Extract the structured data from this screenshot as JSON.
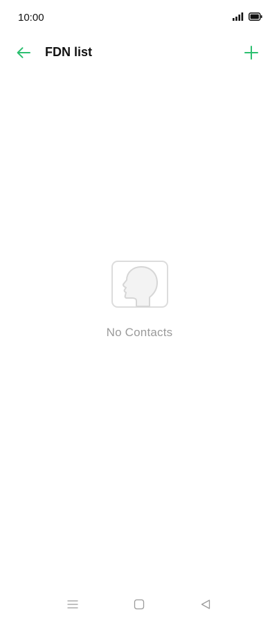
{
  "status_bar": {
    "time": "10:00"
  },
  "header": {
    "title": "FDN list"
  },
  "empty_state": {
    "message": "No Contacts"
  },
  "colors": {
    "accent": "#2bbf6f",
    "muted_text": "#9a9a9a",
    "icon_gray": "#d6d6d6"
  },
  "icons": {
    "back": "back-arrow-icon",
    "add": "plus-icon",
    "empty": "contact-silhouette-icon",
    "nav_menu": "menu-icon",
    "nav_home": "home-square-icon",
    "nav_back": "back-triangle-icon"
  }
}
